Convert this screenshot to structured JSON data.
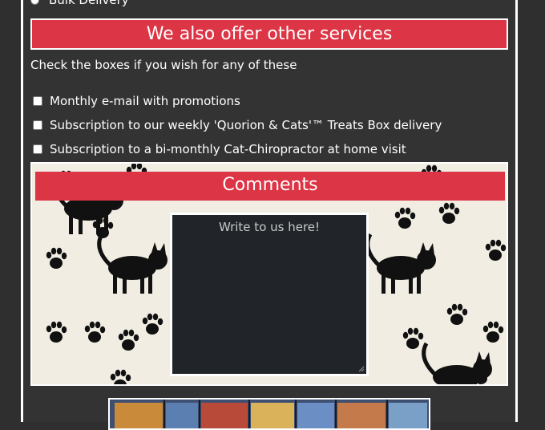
{
  "form": {
    "bulk_delivery_label": "Bulk Delivery",
    "services_heading": "We also offer other services",
    "services_intro": "Check the boxes if you wish for any of these",
    "services": [
      {
        "label": "Monthly e-mail with promotions"
      },
      {
        "label": "Subscription to our weekly 'Quorion & Cats'™ Treats Box delivery"
      },
      {
        "label": "Subscription to a bi-monthly Cat-Chiropractor at home visit"
      }
    ],
    "comments_heading": "Comments",
    "comments_placeholder": "Write to us here!"
  },
  "colors": {
    "accent": "#dc3545",
    "page_background": "#333333",
    "textarea_background": "#212529"
  },
  "icons": [
    "cat-paw-pattern",
    "stained-glass-image"
  ]
}
